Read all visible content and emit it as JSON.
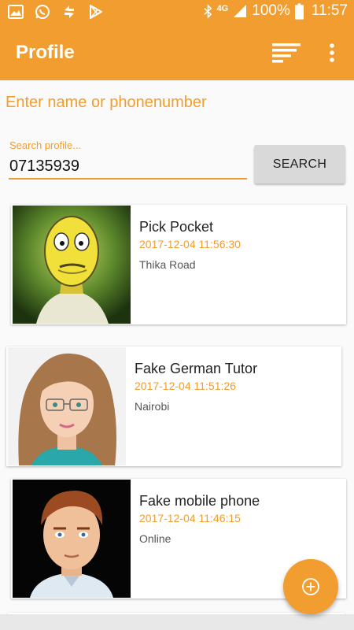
{
  "status_bar": {
    "network": "4G",
    "battery": "100%",
    "time": "11:57",
    "left_icons": [
      "image-icon",
      "whatsapp-icon",
      "sync-icon",
      "play-store-icon"
    ],
    "right_icons": [
      "bluetooth-icon",
      "signal-icon",
      "battery-icon"
    ]
  },
  "app_bar": {
    "title": "Profile",
    "actions": [
      "sort-icon",
      "more-vert-icon"
    ]
  },
  "search": {
    "prompt": "Enter name or phonenumber",
    "label": "Search profile...",
    "value": "07135939",
    "button_label": "SEARCH"
  },
  "profiles": [
    {
      "name": "Pick Pocket",
      "timestamp": "2017-12-04 11:56:30",
      "location": "Thika Road",
      "avatar": "cartoon-yellow-face-avatar"
    },
    {
      "name": "Fake German Tutor",
      "timestamp": "2017-12-04 11:51:26",
      "location": "Nairobi",
      "avatar": "cartoon-woman-glasses-avatar"
    },
    {
      "name": "Fake mobile phone",
      "timestamp": "2017-12-04 11:46:15",
      "location": "Online",
      "avatar": "cartoon-man-avatar"
    }
  ],
  "fab": {
    "icon": "add-circle-icon"
  },
  "colors": {
    "accent": "#f19d2f",
    "button_gray": "#d9d9d9",
    "text_dark": "#222222"
  }
}
